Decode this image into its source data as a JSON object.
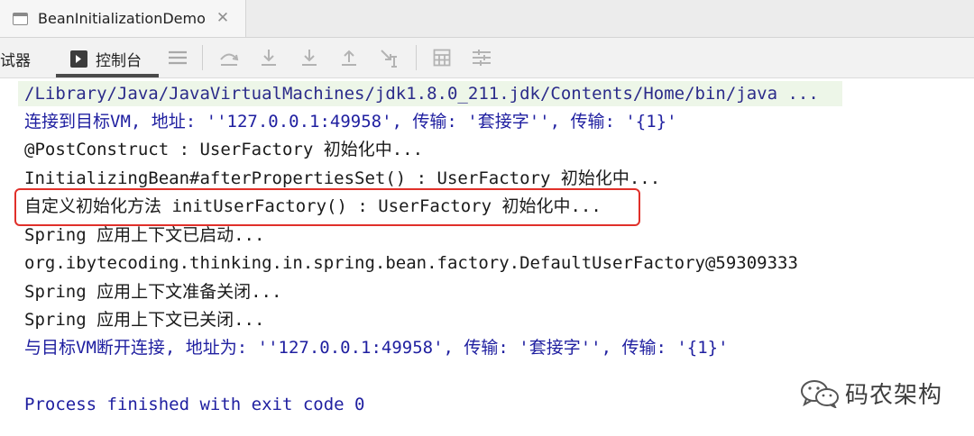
{
  "tab": {
    "title": "BeanInitializationDemo",
    "close_glyph": "✕",
    "icon": "window-icon"
  },
  "toolbar": {
    "debugger_label": "试器",
    "console_label": "控制台",
    "icons": [
      "console-icon",
      "list-icon",
      "step-over-icon",
      "step-into-icon",
      "force-step-into-icon",
      "step-out-icon",
      "run-to-cursor-icon",
      "evaluate-icon",
      "trace-icon"
    ]
  },
  "console": {
    "lines": [
      "/Library/Java/JavaVirtualMachines/jdk1.8.0_211.jdk/Contents/Home/bin/java ...",
      "连接到目标VM, 地址: ''127.0.0.1:49958', 传输: '套接字'', 传输: '{1}'",
      "@PostConstruct : UserFactory 初始化中...",
      "InitializingBean#afterPropertiesSet() : UserFactory 初始化中...",
      "自定义初始化方法 initUserFactory() : UserFactory 初始化中...",
      "Spring 应用上下文已启动...",
      "org.ibytecoding.thinking.in.spring.bean.factory.DefaultUserFactory@59309333",
      "Spring 应用上下文准备关闭...",
      "Spring 应用上下文已关闭...",
      "与目标VM断开连接, 地址为: ''127.0.0.1:49958', 传输: '套接字'', 传输: '{1}'",
      "Process finished with exit code 0"
    ]
  },
  "watermark": {
    "text": "码农架构",
    "icon": "wechat-icon"
  },
  "colors": {
    "command_bg": "#edf6e8",
    "blue_text": "#1f1fa0",
    "highlight": "#e0302a"
  }
}
